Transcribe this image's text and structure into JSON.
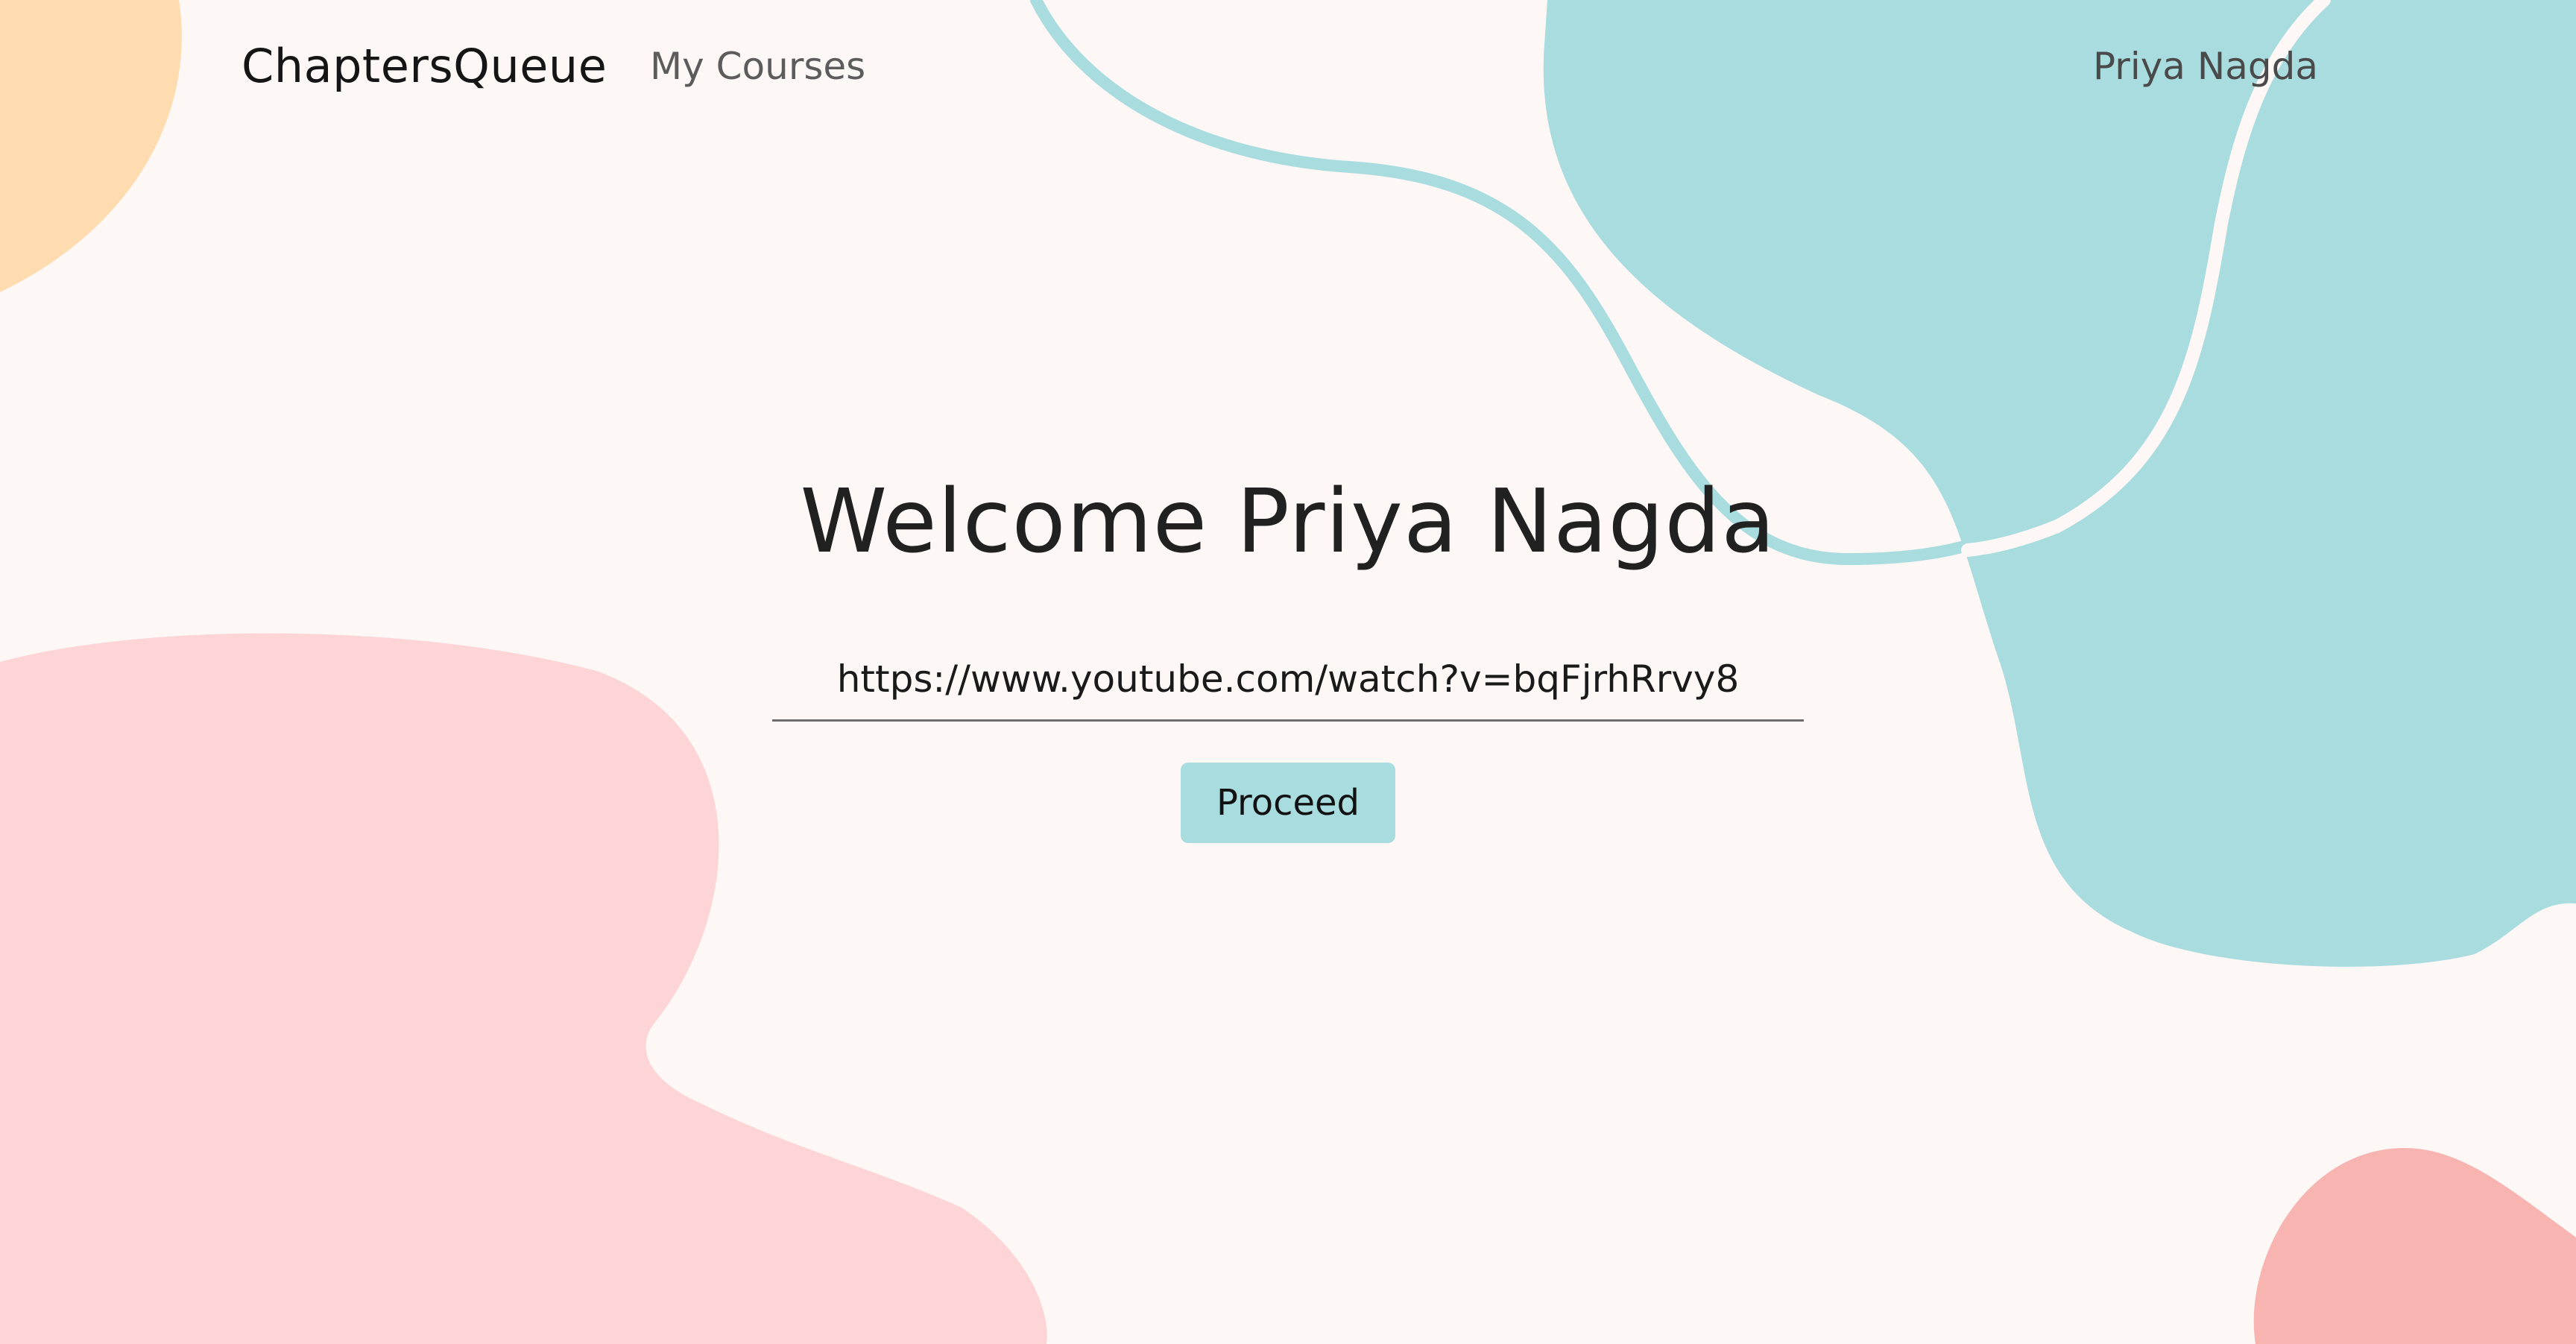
{
  "navbar": {
    "brand": "ChaptersQueue",
    "my_courses": "My Courses",
    "user_name": "Priya Nagda"
  },
  "main": {
    "heading": "Welcome Priya Nagda",
    "url_input_value": "https://www.youtube.com/watch?v=bqFjrhRrvy8",
    "proceed_label": "Proceed"
  },
  "colors": {
    "page_background": "#fdf7f6",
    "teal_blob": "#a8dcdf",
    "pink_blob": "#fdd5d6",
    "peach_blob": "#fedcaf",
    "coral_blob": "#f8b4b0",
    "proceed_button": "#a8dcdf"
  }
}
